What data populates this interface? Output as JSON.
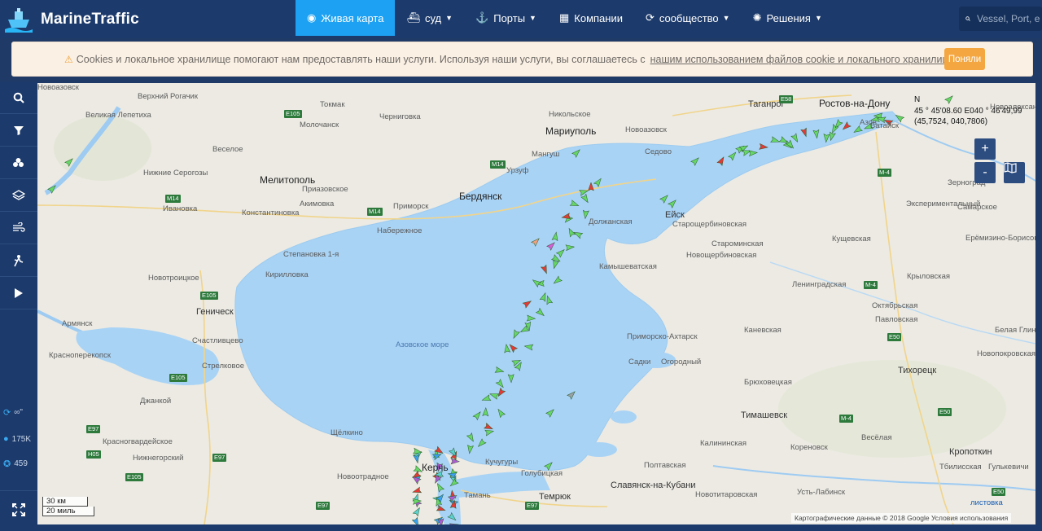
{
  "brand": {
    "name": "MarineTraffic"
  },
  "nav": {
    "items": [
      {
        "label": "Живая карта",
        "icon": "globe-icon",
        "active": true,
        "dropdown": false
      },
      {
        "label": "суд",
        "icon": "ship-icon",
        "active": false,
        "dropdown": true
      },
      {
        "label": "Порты",
        "icon": "anchor-icon",
        "active": false,
        "dropdown": true
      },
      {
        "label": "Компании",
        "icon": "building-icon",
        "active": false,
        "dropdown": false
      },
      {
        "label": "сообщество",
        "icon": "refresh-icon",
        "active": false,
        "dropdown": true
      },
      {
        "label": "Решения",
        "icon": "lightbulb-icon",
        "active": false,
        "dropdown": true
      }
    ],
    "search_placeholder": "Vessel, Port, e"
  },
  "cookie": {
    "text": "Cookies и локальное хранилище помогают нам предоставлять наши услуги. Используя наши услуги, вы соглашаетесь с",
    "link": "нашим использованием файлов cookie и локального хранилища",
    "button": "Поняли"
  },
  "sidebar": {
    "buttons": [
      "search-icon",
      "filter-icon",
      "vessel-groups-icon",
      "layers-icon",
      "wind-icon",
      "tracks-icon",
      "play-icon"
    ],
    "stats": [
      {
        "icon": "refresh-icon",
        "value": "∞\""
      },
      {
        "icon": "info-icon",
        "value": "175K"
      },
      {
        "icon": "target-icon",
        "value": "459"
      }
    ]
  },
  "map": {
    "coordinates": {
      "north": "N",
      "dms": "45 ° 45'08.60 E040 ° 46'49,99",
      "decimal": "(45,7524, 040,7806)"
    },
    "zoom_in": "+",
    "zoom_out": "-",
    "scale_km": "30 км",
    "scale_mi": "20 миль",
    "attribution": "Картографические данные © 2018 Google   Условия использования",
    "map_type_link": "листовка",
    "labels": [
      {
        "text": "Ростов-на-Дону",
        "kind": "city"
      },
      {
        "text": "Таганрог",
        "kind": "town"
      },
      {
        "text": "Мариуполь",
        "kind": "city"
      },
      {
        "text": "Мелитополь",
        "kind": "city"
      },
      {
        "text": "Бердянск",
        "kind": "city"
      },
      {
        "text": "Керчь",
        "kind": "city"
      },
      {
        "text": "Геническ",
        "kind": "town"
      },
      {
        "text": "Азовское море",
        "kind": "sea"
      },
      {
        "text": "Ейск",
        "kind": "town"
      },
      {
        "text": "Темрюк",
        "kind": "town"
      },
      {
        "text": "Тихорецк",
        "kind": "town"
      },
      {
        "text": "Тимашевск",
        "kind": "town"
      },
      {
        "text": "Кропоткин",
        "kind": "town"
      },
      {
        "text": "Славянск-на-Кубани",
        "kind": "town"
      },
      {
        "text": "Приморско-Ахтарск",
        "kind": "small"
      },
      {
        "text": "Каневская",
        "kind": "small"
      },
      {
        "text": "Брюховецкая",
        "kind": "small"
      },
      {
        "text": "Джанкой",
        "kind": "small"
      },
      {
        "text": "Кореновск",
        "kind": "small"
      },
      {
        "text": "Азов",
        "kind": "small"
      },
      {
        "text": "Батайск",
        "kind": "small"
      },
      {
        "text": "Великая Лепетиха",
        "kind": "small"
      },
      {
        "text": "Верхний Рогачик",
        "kind": "small"
      },
      {
        "text": "Токмак",
        "kind": "small"
      },
      {
        "text": "Молочанск",
        "kind": "small"
      },
      {
        "text": "Черниговка",
        "kind": "small"
      },
      {
        "text": "Никольское",
        "kind": "small"
      },
      {
        "text": "Новоазовск",
        "kind": "small"
      },
      {
        "text": "Седово",
        "kind": "small"
      },
      {
        "text": "Мангуш",
        "kind": "small"
      },
      {
        "text": "Урзуф",
        "kind": "small"
      },
      {
        "text": "Веселое",
        "kind": "small"
      },
      {
        "text": "Нижние Серогозы",
        "kind": "small"
      },
      {
        "text": "Ивановка",
        "kind": "small"
      },
      {
        "text": "Константиновка",
        "kind": "small"
      },
      {
        "text": "Приазовское",
        "kind": "small"
      },
      {
        "text": "Акимовка",
        "kind": "small"
      },
      {
        "text": "Приморск",
        "kind": "small"
      },
      {
        "text": "Набережное",
        "kind": "small"
      },
      {
        "text": "Степановка 1-я",
        "kind": "small"
      },
      {
        "text": "Кирилловка",
        "kind": "small"
      },
      {
        "text": "Новотроицкое",
        "kind": "small"
      },
      {
        "text": "Армянск",
        "kind": "small"
      },
      {
        "text": "Красноперекопск",
        "kind": "small"
      },
      {
        "text": "Счастливцево",
        "kind": "small"
      },
      {
        "text": "Стрелковое",
        "kind": "small"
      },
      {
        "text": "Красногвардейское",
        "kind": "small"
      },
      {
        "text": "Нижнегорский",
        "kind": "small"
      },
      {
        "text": "Щёлкино",
        "kind": "small"
      },
      {
        "text": "Новоотрадное",
        "kind": "small"
      },
      {
        "text": "Кучугуры",
        "kind": "small"
      },
      {
        "text": "Голубицкая",
        "kind": "small"
      },
      {
        "text": "Тамань",
        "kind": "small"
      },
      {
        "text": "Должанская",
        "kind": "small"
      },
      {
        "text": "Камышеватская",
        "kind": "small"
      },
      {
        "text": "Старощербиновская",
        "kind": "small"
      },
      {
        "text": "Новощербиновская",
        "kind": "small"
      },
      {
        "text": "Староминская",
        "kind": "small"
      },
      {
        "text": "Ленинградская",
        "kind": "small"
      },
      {
        "text": "Кущевская",
        "kind": "small"
      },
      {
        "text": "Ерёмизино-Борисовка",
        "kind": "small"
      },
      {
        "text": "Крыловская",
        "kind": "small"
      },
      {
        "text": "Октябрьская",
        "kind": "small"
      },
      {
        "text": "Павловская",
        "kind": "small"
      },
      {
        "text": "Белая Глина",
        "kind": "small"
      },
      {
        "text": "Новопокровская",
        "kind": "small"
      },
      {
        "text": "Садки",
        "kind": "small"
      },
      {
        "text": "Огородный",
        "kind": "small"
      },
      {
        "text": "Калининская",
        "kind": "small"
      },
      {
        "text": "Полтавская",
        "kind": "small"
      },
      {
        "text": "Новотитаровская",
        "kind": "small"
      },
      {
        "text": "Усть-Лабинск",
        "kind": "small"
      },
      {
        "text": "Весёлая",
        "kind": "small"
      },
      {
        "text": "Тбилисская",
        "kind": "small"
      },
      {
        "text": "Гулькевичи",
        "kind": "small"
      },
      {
        "text": "Зерноград",
        "kind": "small"
      },
      {
        "text": "Экспериментальный",
        "kind": "small"
      },
      {
        "text": "Самарское",
        "kind": "small"
      },
      {
        "text": "Новоалександровка",
        "kind": "small"
      },
      {
        "text": "Новоазовск",
        "kind": "small"
      }
    ],
    "roads": [
      "E105",
      "M14",
      "E58",
      "M-4",
      "E97",
      "E50",
      "H05"
    ]
  }
}
